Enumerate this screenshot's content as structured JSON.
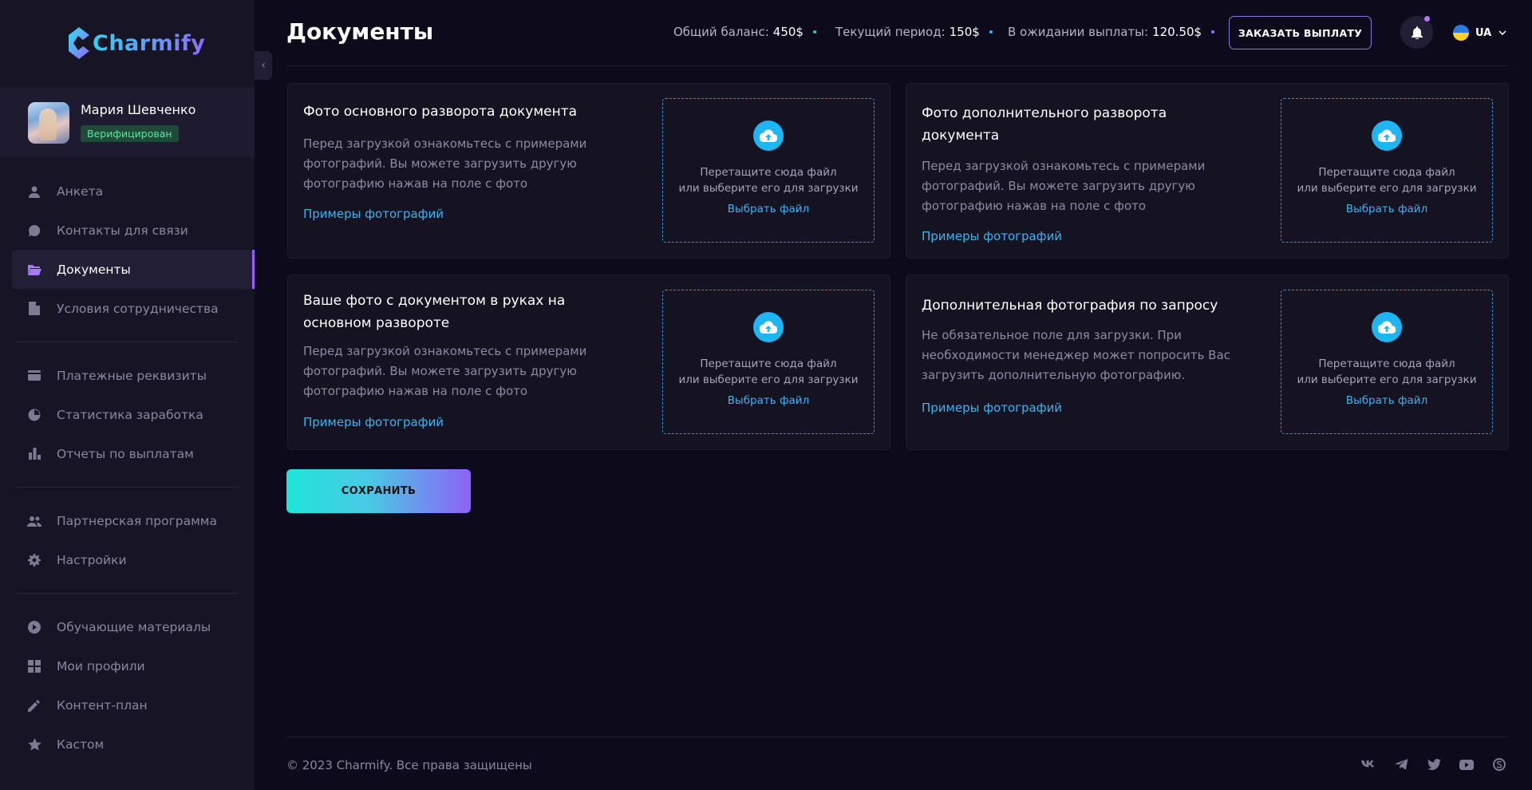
{
  "brand": {
    "name": "Charmify"
  },
  "profile": {
    "name": "Мария Шевченко",
    "status": "Верифицирован"
  },
  "sidebar": {
    "items": [
      {
        "label": "Анкета",
        "icon": "person-icon"
      },
      {
        "label": "Контакты для связи",
        "icon": "chat-icon"
      },
      {
        "label": "Документы",
        "icon": "folder-icon",
        "active": true
      },
      {
        "label": "Условия сотрудничества",
        "icon": "file-icon"
      },
      {
        "label": "Платежные реквизиты",
        "icon": "card-icon"
      },
      {
        "label": "Статистика заработка",
        "icon": "pie-icon"
      },
      {
        "label": "Отчеты по выплатам",
        "icon": "bar-chart-icon"
      },
      {
        "label": "Партнерская программа",
        "icon": "group-icon"
      },
      {
        "label": "Настройки",
        "icon": "gear-icon"
      },
      {
        "label": "Обучающие материалы",
        "icon": "play-icon"
      },
      {
        "label": "Мои профили",
        "icon": "grid-icon"
      },
      {
        "label": "Контент-план",
        "icon": "pencil-icon"
      },
      {
        "label": "Кастом",
        "icon": "star-icon"
      }
    ]
  },
  "header": {
    "title": "Документы",
    "total_balance_label": "Общий баланс:",
    "total_balance": "450$",
    "current_period_label": "Текущий период:",
    "current_period": "150$",
    "pending_label": "В ожидании выплаты:",
    "pending": "120.50$",
    "order_payout": "ЗАКАЗАТЬ ВЫПЛАТУ",
    "language": "UA"
  },
  "colors": {
    "accent": "#9b5cf6",
    "link": "#3cb4f2",
    "success": "#5fe3a0",
    "background": "#0d0a1b"
  },
  "documents": [
    {
      "title": "Фото основного разворота документа",
      "description": "Перед загрузкой ознакомьтесь с примерами фотографий. Вы можете загрузить другую фотографию нажав на поле с фото",
      "examples_link": "Примеры фотографий"
    },
    {
      "title": "Фото дополнительного разворота документа",
      "description": "Перед загрузкой ознакомьтесь с примерами фотографий. Вы можете загрузить другую фотографию нажав на поле с фото",
      "examples_link": "Примеры фотографий"
    },
    {
      "title": "Ваше фото с документом в руках на основном развороте",
      "description": "Перед загрузкой ознакомьтесь с примерами фотографий. Вы можете загрузить другую фотографию нажав на поле с фото",
      "examples_link": "Примеры фотографий"
    },
    {
      "title": "Дополнительная фотография по запросу",
      "description": "Не обязательное поле для загрузки. При необходимости менеджер может попросить Вас загрузить дополнительную фотографию.",
      "examples_link": "Примеры фотографий"
    }
  ],
  "dropzone": {
    "line1": "Перетащите сюда файл",
    "line2": "или выберите его для загрузки",
    "select_file": "Выбрать файл"
  },
  "save_button": "СОХРАНИТЬ",
  "footer": {
    "copyright": "© 2023 Charmify. Все права защищены",
    "socials": [
      "vk-icon",
      "telegram-icon",
      "twitter-icon",
      "youtube-icon",
      "skype-icon"
    ]
  }
}
